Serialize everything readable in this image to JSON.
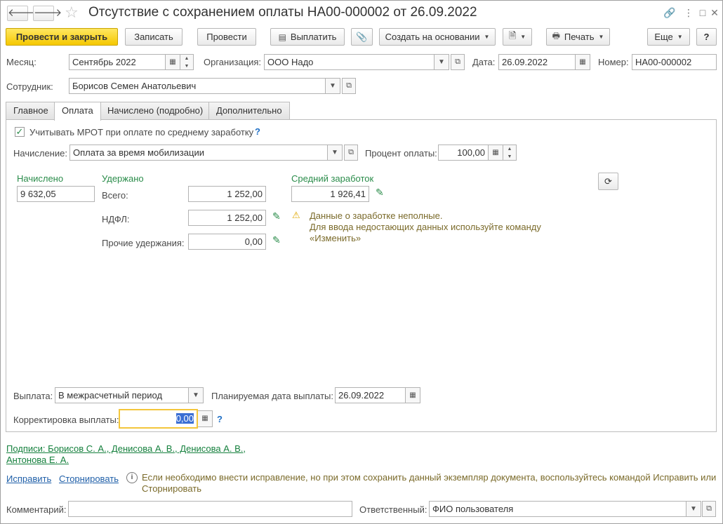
{
  "window": {
    "title": "Отсутствие с сохранением оплаты НА00-000002 от 26.09.2022",
    "nav_back": "🡐",
    "nav_forward": "🡒"
  },
  "toolbar": {
    "post_close": "Провести и закрыть",
    "save": "Записать",
    "post": "Провести",
    "pay": "Выплатить",
    "create_based": "Создать на основании",
    "print": "Печать",
    "more": "Еще",
    "help": "?"
  },
  "header": {
    "month_label": "Месяц:",
    "month_value": "Сентябрь 2022",
    "org_label": "Организация:",
    "org_value": "ООО Надо",
    "date_label": "Дата:",
    "date_value": "26.09.2022",
    "number_label": "Номер:",
    "number_value": "НА00-000002",
    "employee_label": "Сотрудник:",
    "employee_value": "Борисов Семен Анатольевич"
  },
  "tabs": [
    {
      "label": "Главное"
    },
    {
      "label": "Оплата"
    },
    {
      "label": "Начислено (подробно)"
    },
    {
      "label": "Дополнительно"
    }
  ],
  "payment": {
    "mrot_label": "Учитывать МРОТ при оплате по среднему заработку",
    "mrot_checked": true,
    "accrual_label": "Начисление:",
    "accrual_value": "Оплата за время мобилизации",
    "percent_label": "Процент оплаты:",
    "percent_value": "100,00",
    "accrued_header": "Начислено",
    "accrued_value": "9 632,05",
    "withheld_header": "Удержано",
    "total_label": "Всего:",
    "total_value": "1 252,00",
    "ndfl_label": "НДФЛ:",
    "ndfl_value": "1 252,00",
    "other_label": "Прочие удержания:",
    "other_value": "0,00",
    "avg_header": "Средний заработок",
    "avg_value": "1 926,41",
    "warning_line1": "Данные о заработке неполные.",
    "warning_line2": "Для ввода недостающих данных используйте команду",
    "warning_line3": "«Изменить»",
    "payout_label": "Выплата:",
    "payout_value": "В межрасчетный период",
    "planned_date_label": "Планируемая дата выплаты:",
    "planned_date_value": "26.09.2022",
    "correction_label": "Корректировка выплаты:",
    "correction_value": "0,00"
  },
  "footer": {
    "signatures_line1": "Подписи: Борисов С. А., Денисова А. В., Денисова А. В.,",
    "signatures_line2": "Антонова Е. А.",
    "fix_link": "Исправить",
    "reverse_link": "Сторнировать",
    "info_line1": "Если необходимо внести исправление, но при этом сохранить данный экземпляр документа, воспользуйтесь командой Исправить или",
    "info_line2": "Сторнировать",
    "comment_label": "Комментарий:",
    "comment_value": "",
    "responsible_label": "Ответственный:",
    "responsible_value": "ФИО пользователя"
  },
  "colors": {
    "primary_button": "#f5c800",
    "green_label": "#2a8c4a",
    "link_blue": "#1f5fa8",
    "focus": "#f3c63b"
  }
}
